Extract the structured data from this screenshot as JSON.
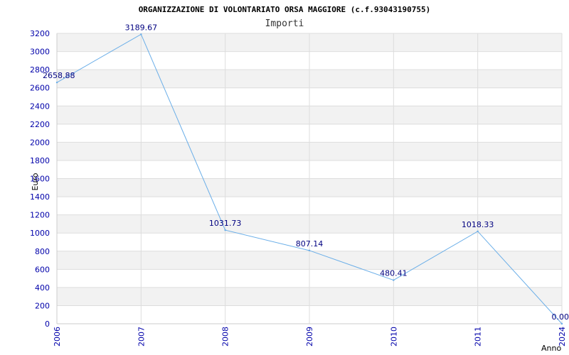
{
  "chart_data": {
    "type": "line",
    "title": "ORGANIZZAZIONE DI VOLONTARIATO ORSA MAGGIORE (c.f.93043190755)",
    "subtitle": "Importi",
    "xlabel": "Anno",
    "ylabel": "Euro",
    "categories": [
      "2006",
      "2007",
      "2008",
      "2009",
      "2010",
      "2011",
      "2024"
    ],
    "series": [
      {
        "values": [
          2658.88,
          3189.67,
          1031.73,
          807.14,
          480.41,
          1018.33,
          0.0
        ],
        "labels": [
          "2658.88",
          "3189.67",
          "1031.73",
          "807.14",
          "480.41",
          "1018.33",
          "0.00"
        ]
      }
    ],
    "ylim": [
      0,
      3200
    ],
    "yticks": [
      "0",
      "200",
      "400",
      "600",
      "800",
      "1000",
      "1200",
      "1400",
      "1600",
      "1800",
      "2000",
      "2200",
      "2400",
      "2600",
      "2800",
      "3000",
      "3200"
    ],
    "grid": true,
    "colors": {
      "line": "#6aaee8",
      "band": "#f2f2f2",
      "gridline": "#dddddd",
      "tick_text": "#0000aa",
      "label_text": "#000080"
    }
  }
}
